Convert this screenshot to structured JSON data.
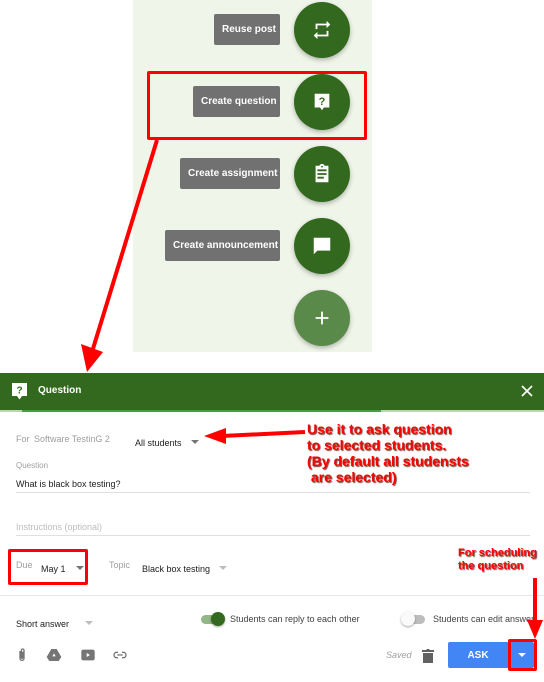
{
  "speed_dial": {
    "items": [
      {
        "label": "Reuse post",
        "icon": "repeat-icon"
      },
      {
        "label": "Create question",
        "icon": "question-icon"
      },
      {
        "label": "Create assignment",
        "icon": "assignment-icon"
      },
      {
        "label": "Create announcement",
        "icon": "announcement-icon"
      }
    ],
    "main_icon": "plus-icon"
  },
  "dialog": {
    "title": "Question",
    "header_color": "#33691e",
    "upload_progress": 0.66,
    "for_label": "For",
    "class_name": "Software TestinG 2",
    "audience": "All students",
    "question_label": "Question",
    "question_value": "What is black box testing?",
    "instructions_placeholder": "Instructions (optional)",
    "due_label": "Due",
    "due_value": "May 1",
    "topic_label": "Topic",
    "topic_value": "Black box testing",
    "answer_type": "Short answer",
    "toggles": [
      {
        "label": "Students can reply to each other",
        "on": true
      },
      {
        "label": "Students can edit answer",
        "on": false
      }
    ],
    "attachments": [
      "attach-icon",
      "drive-icon",
      "youtube-icon",
      "link-icon"
    ],
    "status": "Saved",
    "ask_label": "ASK",
    "accent": "#4285f4"
  },
  "annotations": {
    "audience_note": "Use it to ask question\nto selected students.\n(By default all studensts\n are selected)",
    "schedule_note": "For scheduling\nthe question",
    "color": "#ff0000"
  }
}
